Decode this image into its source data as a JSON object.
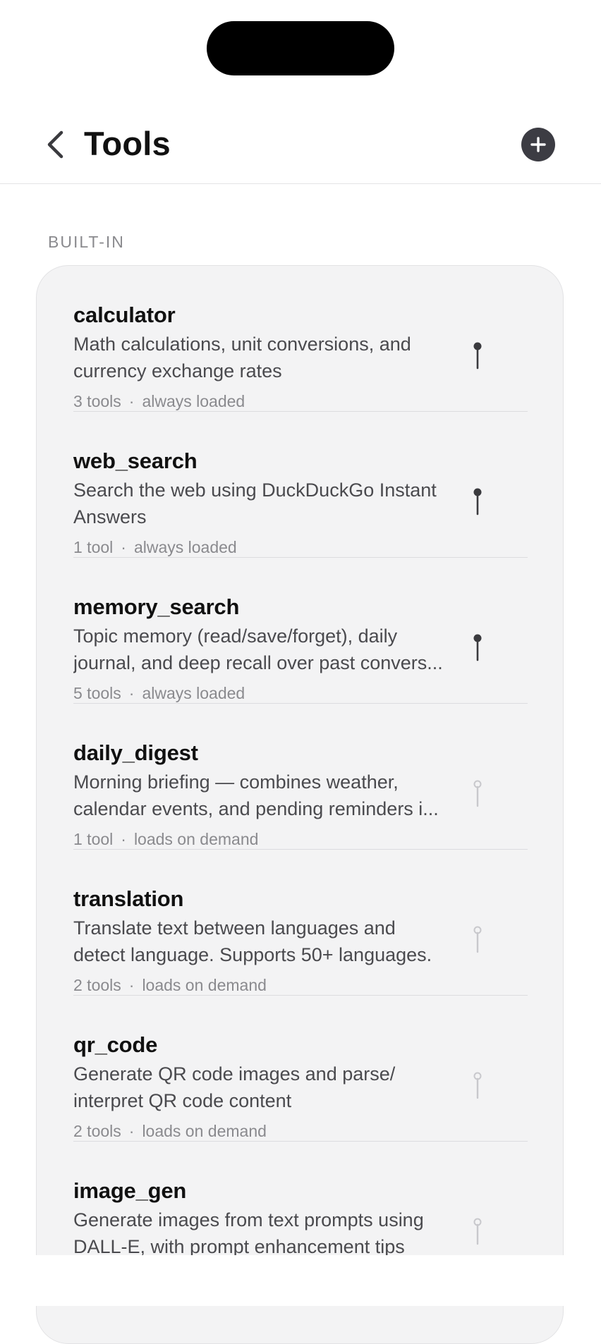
{
  "header": {
    "title": "Tools"
  },
  "section": {
    "label": "BUILT-IN"
  },
  "colors": {
    "pin_active": "#3a3a3e",
    "pin_inactive": "#c8c8cc",
    "add_button": "#3c3c43"
  },
  "tools": [
    {
      "name": "calculator",
      "desc_line1": "Math calculations, unit conversions, and",
      "desc_line2": "currency exchange rates",
      "count": "3 tools",
      "sep": "·",
      "load": "always loaded",
      "pinned": true
    },
    {
      "name": "web_search",
      "desc_line1": "Search the web using DuckDuckGo Instant",
      "desc_line2": "Answers",
      "count": "1 tool",
      "sep": "·",
      "load": "always loaded",
      "pinned": true
    },
    {
      "name": "memory_search",
      "desc_line1": "Topic memory (read/save/forget), daily",
      "desc_line2": "journal, and deep recall over past convers...",
      "count": "5 tools",
      "sep": "·",
      "load": "always loaded",
      "pinned": true
    },
    {
      "name": "daily_digest",
      "desc_line1": "Morning briefing — combines weather,",
      "desc_line2": "calendar events, and pending reminders i...",
      "count": "1 tool",
      "sep": "·",
      "load": "loads on demand",
      "pinned": false
    },
    {
      "name": "translation",
      "desc_line1": "Translate text between languages and",
      "desc_line2": "detect language. Supports 50+ languages.",
      "count": "2 tools",
      "sep": "·",
      "load": "loads on demand",
      "pinned": false
    },
    {
      "name": "qr_code",
      "desc_line1": "Generate QR code images and parse/",
      "desc_line2": "interpret QR code content",
      "count": "2 tools",
      "sep": "·",
      "load": "loads on demand",
      "pinned": false
    },
    {
      "name": "image_gen",
      "desc_line1": "Generate images from text prompts using",
      "desc_line2": "DALL-E, with prompt enhancement tips",
      "count": "",
      "sep": "",
      "load": "",
      "pinned": false
    }
  ]
}
